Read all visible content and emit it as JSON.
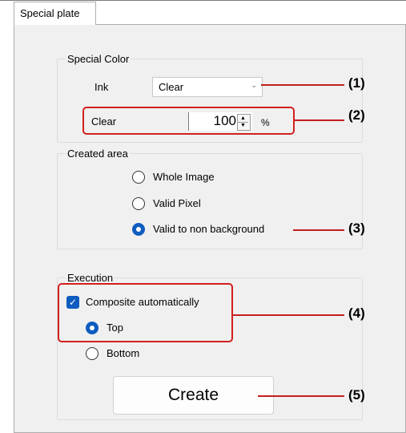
{
  "tab": {
    "label": "Special plate"
  },
  "special_color": {
    "legend": "Special Color",
    "ink_label": "Ink",
    "ink_value": "Clear",
    "amount_label": "Clear",
    "amount_value": "100",
    "amount_unit": "%"
  },
  "created_area": {
    "legend": "Created area",
    "options": [
      "Whole Image",
      "Valid Pixel",
      "Valid to non background"
    ],
    "selected": "Valid to non background"
  },
  "execution": {
    "legend": "Execution",
    "composite_label": "Composite automatically",
    "composite_checked": true,
    "positions": [
      "Top",
      "Bottom"
    ],
    "selected_position": "Top",
    "create_label": "Create"
  },
  "callouts": [
    "(1)",
    "(2)",
    "(3)",
    "(4)",
    "(5)"
  ],
  "colors": {
    "highlight": "#d31f1f",
    "accent": "#0f5cc0"
  }
}
